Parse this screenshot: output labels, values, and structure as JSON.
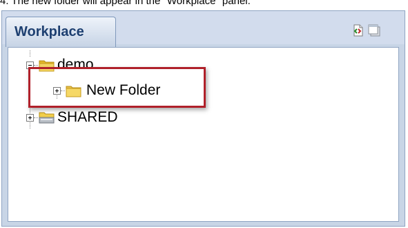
{
  "caption": "4. The new folder will appear in the \"Workplace\" panel.",
  "panel": {
    "tab_label": "Workplace",
    "toolbar": {
      "refresh_icon": "refresh-icon",
      "window_icon": "window-icon"
    }
  },
  "tree": {
    "nodes": [
      {
        "label": "demo",
        "icon": "folder-open-icon",
        "expanded": true
      },
      {
        "label": "New Folder",
        "icon": "folder-icon",
        "expanded": false,
        "parent": "demo"
      },
      {
        "label": "SHARED",
        "icon": "shared-folder-icon",
        "expanded": false
      }
    ]
  },
  "colors": {
    "tab_text": "#1d3f70",
    "highlight_border": "#b0202a",
    "folder_yellow": "#f2cf4a",
    "panel_bg": "#c8d5e6"
  }
}
